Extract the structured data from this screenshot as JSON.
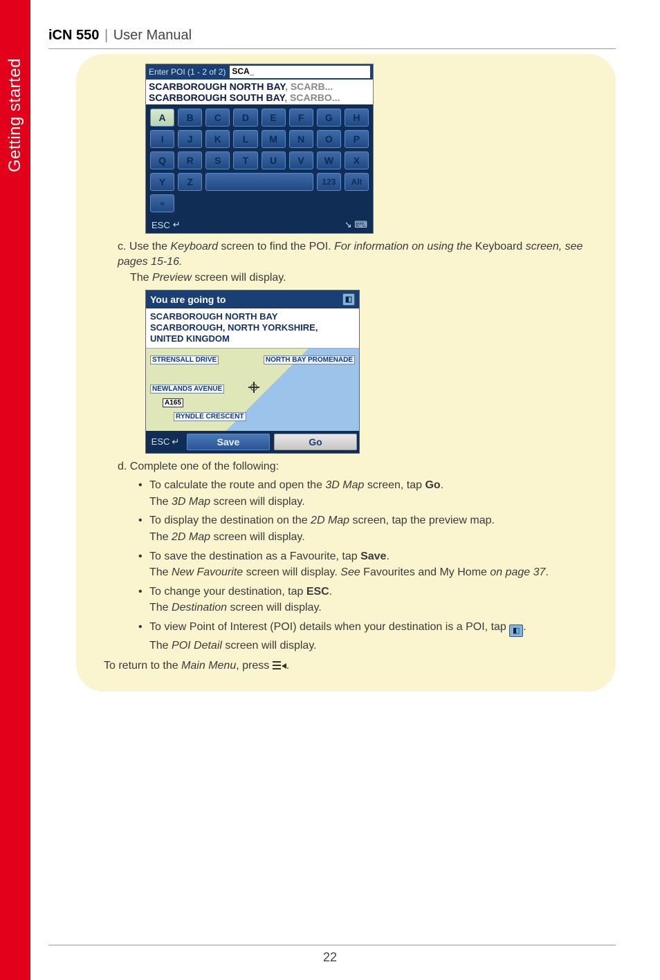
{
  "doc": {
    "product": "iCN 550",
    "section": "User Manual",
    "side_tab": "Getting started",
    "page_number": "22"
  },
  "kb": {
    "title": "Enter POI (1 - 2 of 2)",
    "input": "SCA_",
    "results": [
      {
        "main": "SCARBOROUGH NORTH BAY",
        "tail": ", SCARB..."
      },
      {
        "main": "SCARBOROUGH SOUTH BAY",
        "tail": ", SCARBO..."
      }
    ],
    "rows": [
      [
        "A",
        "B",
        "C",
        "D",
        "E",
        "F",
        "G",
        "H"
      ],
      [
        "I",
        "J",
        "K",
        "L",
        "M",
        "N",
        "O",
        "P"
      ],
      [
        "Q",
        "R",
        "S",
        "T",
        "U",
        "V",
        "W",
        "X"
      ]
    ],
    "row4": {
      "y": "Y",
      "z": "Z",
      "space": "",
      "n123": "123",
      "alt": "Alt",
      "back": "«"
    },
    "esc": "ESC"
  },
  "step_c": {
    "label": "c. ",
    "t1": "Use the ",
    "kbd": "Keyboard",
    "t2": " screen to find the POI. ",
    "info1": "For information on using the ",
    "info_kbd": "Keyboard",
    "info2": " screen, see pages 15-16.",
    "after1": "The ",
    "after_prev": "Preview",
    "after2": " screen will display."
  },
  "pv": {
    "title": "You are going to",
    "addr1": "SCARBOROUGH NORTH BAY",
    "addr2": "SCARBOROUGH, NORTH YORKSHIRE,",
    "addr3": "UNITED KINGDOM",
    "roads": {
      "r1": "STRENSALL DRIVE",
      "r2": "NORTH BAY PROMENADE",
      "r3": "NEWLANDS AVENUE",
      "r4": "A165",
      "r5": "RYNDLE CRESCENT"
    },
    "esc": "ESC",
    "save": "Save",
    "go": "Go"
  },
  "step_d": {
    "label": "d. ",
    "text": "Complete one of the following:"
  },
  "bullets": {
    "b1": {
      "t1": "To calculate the route and open the ",
      "i1": "3D Map",
      "t2": " screen, tap ",
      "b": "Go",
      "t3": ".",
      "s1": "The ",
      "si": "3D Map",
      "s2": " screen will display."
    },
    "b2": {
      "t1": "To display the destination on the ",
      "i1": "2D Map",
      "t2": " screen, tap the preview map.",
      "s1": "The ",
      "si": "2D Map",
      "s2": " screen will display."
    },
    "b3": {
      "t1": "To save the destination as a Favourite, tap ",
      "b": "Save",
      "t2": ".",
      "s1": "The ",
      "si": "New Favourite",
      "s2": " screen will display. ",
      "see": "See",
      "s3": " Favourites and My Home ",
      "si2": "on page 37",
      "s4": "."
    },
    "b4": {
      "t1": "To change your destination, tap ",
      "b": "ESC",
      "t2": ".",
      "s1": "The ",
      "si": "Destination",
      "s2": " screen will display."
    },
    "b5": {
      "t1": "To view Point of Interest (POI) details when your destination is a POI, tap ",
      "t2": ".",
      "s1": "The ",
      "si": "POI Detail",
      "s2": " screen will display."
    }
  },
  "return_line": {
    "t1": "To return to the ",
    "mi": "Main Menu",
    "t2": ", press ",
    "t3": "."
  }
}
